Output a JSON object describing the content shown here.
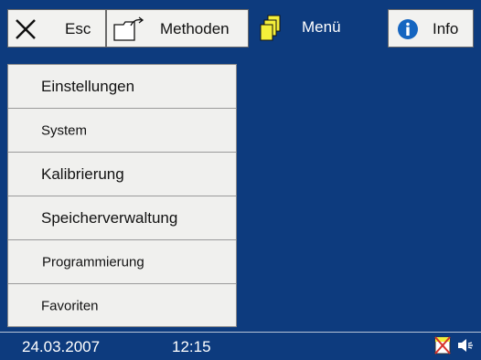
{
  "tabs": {
    "esc": {
      "label": "Esc",
      "icon": "close-icon"
    },
    "methods": {
      "label": "Methoden",
      "icon": "folder-open-icon"
    },
    "menu": {
      "label": "Menü",
      "icon": "documents-stack-icon",
      "active": true
    },
    "info": {
      "label": "Info",
      "icon": "info-icon"
    }
  },
  "menu": {
    "items": [
      {
        "label": "Einstellungen"
      },
      {
        "label": "System"
      },
      {
        "label": "Kalibrierung"
      },
      {
        "label": "Speicherverwaltung"
      },
      {
        "label": "Programmierung"
      },
      {
        "label": "Favoriten"
      }
    ]
  },
  "status": {
    "date": "24.03.2007",
    "time": "12:15",
    "icons": [
      "printer-disabled-icon",
      "speaker-icon"
    ]
  },
  "colors": {
    "background": "#0d3b7e",
    "panel": "#f0f0ee",
    "info_blue": "#1565c0",
    "doc_yellow": "#f4ef3a",
    "disabled_red": "#d8322b"
  }
}
